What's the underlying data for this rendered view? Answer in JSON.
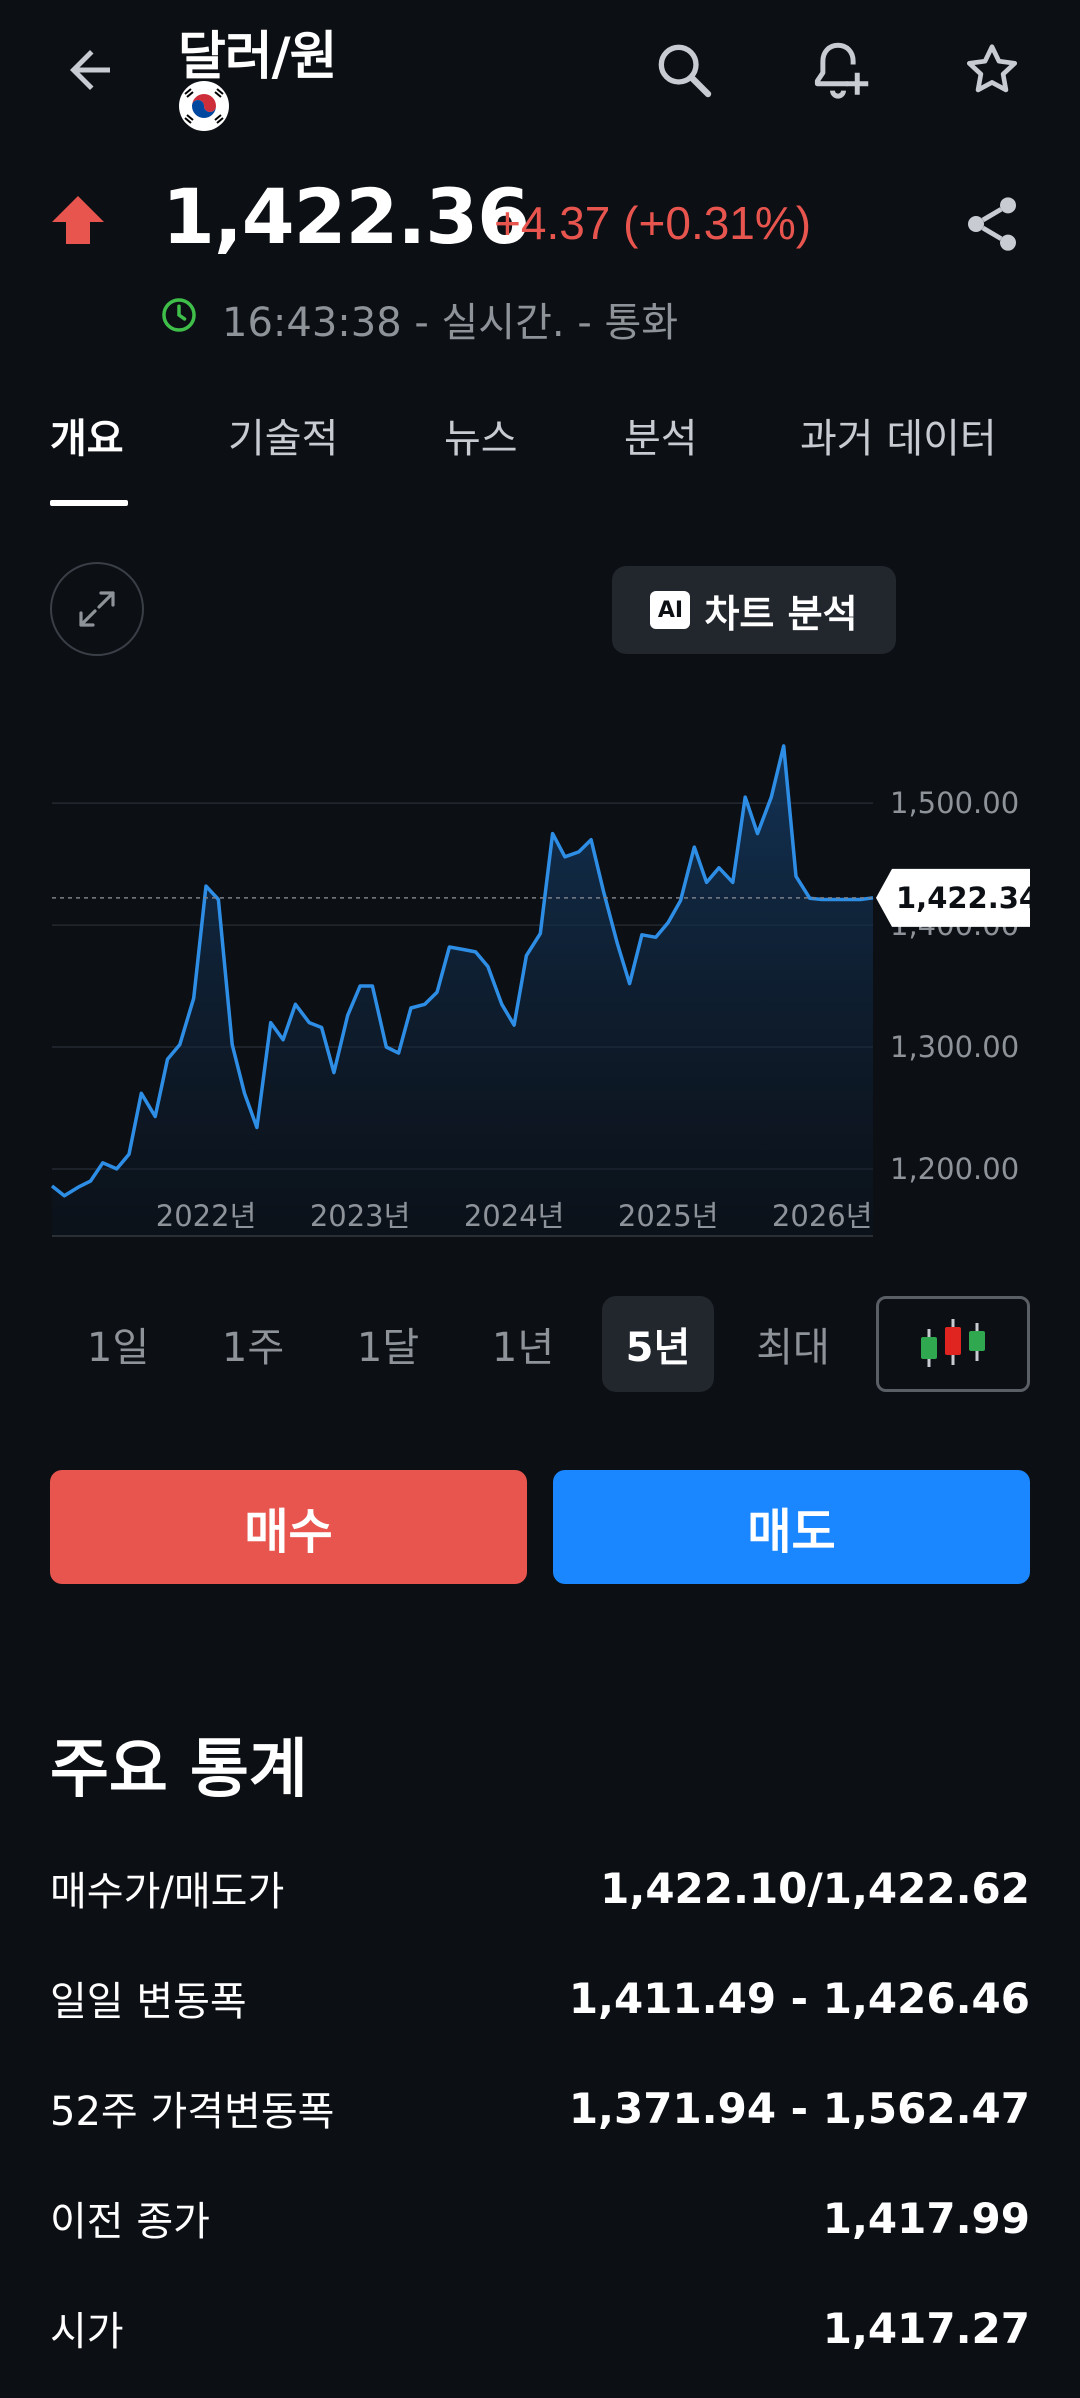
{
  "header": {
    "title": "달러/원",
    "flag_icon": "south-korea-flag-icon"
  },
  "quote": {
    "direction": "up",
    "price": "1,422.36",
    "change": "+4.37 (+0.31%)",
    "status": "16:43:38 - 실시간. - 통화"
  },
  "tabs": [
    "개요",
    "기술적",
    "뉴스",
    "분석",
    "과거 데이터"
  ],
  "active_tab": "개요",
  "chart_toolbar": {
    "ai_label": "차트 분석",
    "ai_badge": "AI"
  },
  "chart_data": {
    "type": "area",
    "x_labels": [
      "2022년",
      "2023년",
      "2024년",
      "2025년",
      "2026년"
    ],
    "y_ticks": [
      "1,500.00",
      "1,400.00",
      "1,300.00",
      "1,200.00"
    ],
    "y_tick_values": [
      1500,
      1400,
      1300,
      1200
    ],
    "ylim": [
      1145,
      1560
    ],
    "last_value_label": "1,422.34",
    "last_value": 1422.34,
    "x": [
      2021.0,
      2021.08,
      2021.17,
      2021.25,
      2021.33,
      2021.42,
      2021.5,
      2021.58,
      2021.67,
      2021.75,
      2021.83,
      2021.92,
      2022.0,
      2022.08,
      2022.17,
      2022.25,
      2022.33,
      2022.42,
      2022.5,
      2022.58,
      2022.67,
      2022.75,
      2022.83,
      2022.92,
      2023.0,
      2023.08,
      2023.17,
      2023.25,
      2023.33,
      2023.42,
      2023.5,
      2023.58,
      2023.67,
      2023.75,
      2023.83,
      2023.92,
      2024.0,
      2024.08,
      2024.17,
      2024.25,
      2024.33,
      2024.42,
      2024.5,
      2024.58,
      2024.67,
      2024.75,
      2024.83,
      2024.92,
      2025.0,
      2025.08,
      2025.17,
      2025.25,
      2025.33,
      2025.42,
      2025.5,
      2025.58,
      2025.67,
      2025.75,
      2025.83,
      2025.92,
      2026.0,
      2026.08,
      2026.17,
      2026.25,
      2026.33
    ],
    "values": [
      1186,
      1178,
      1185,
      1190,
      1205,
      1200,
      1212,
      1262,
      1243,
      1290,
      1302,
      1340,
      1432,
      1421,
      1302,
      1262,
      1234,
      1320,
      1306,
      1335,
      1320,
      1316,
      1279,
      1326,
      1350,
      1350,
      1300,
      1295,
      1332,
      1335,
      1345,
      1382,
      1380,
      1378,
      1366,
      1335,
      1318,
      1375,
      1393,
      1475,
      1456,
      1460,
      1470,
      1428,
      1385,
      1352,
      1392,
      1390,
      1402,
      1420,
      1464,
      1435,
      1447,
      1435,
      1505,
      1475,
      1505,
      1547,
      1440,
      1422,
      1421,
      1421,
      1421,
      1421,
      1422.34
    ],
    "grid": true,
    "line_color": "#2e8ee6"
  },
  "ranges": [
    "1일",
    "1주",
    "1달",
    "1년",
    "5년",
    "최대"
  ],
  "active_range": "5년",
  "actions": {
    "buy": "매수",
    "sell": "매도"
  },
  "stats": {
    "title": "주요 통계",
    "rows": [
      {
        "label": "매수가/매도가",
        "value": "1,422.10/1,422.62"
      },
      {
        "label": "일일 변동폭",
        "value": "1,411.49 - 1,426.46"
      },
      {
        "label": "52주 가격변동폭",
        "value": "1,371.94 - 1,562.47"
      },
      {
        "label": "이전 종가",
        "value": "1,417.99"
      },
      {
        "label": "시가",
        "value": "1,417.27"
      }
    ]
  },
  "colors": {
    "up": "#e8554e",
    "buy": "#e8554e",
    "sell": "#1a86ff",
    "live_dot": "#3fbf4a"
  }
}
